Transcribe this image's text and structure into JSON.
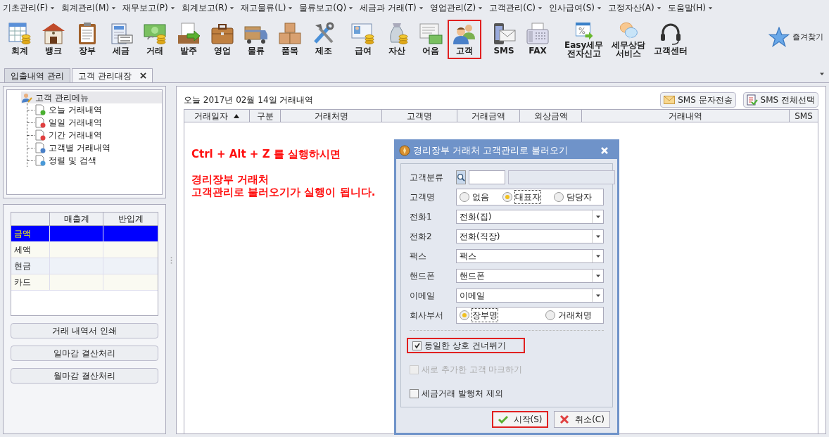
{
  "menu_bar": [
    {
      "label": "기초관리(F)"
    },
    {
      "label": "회계관리(M)"
    },
    {
      "label": "재무보고(P)"
    },
    {
      "label": "회계보고(R)"
    },
    {
      "label": "재고물류(L)"
    },
    {
      "label": "물류보고(Q)"
    },
    {
      "label": "세금과 거래(T)"
    },
    {
      "label": "영업관리(Z)"
    },
    {
      "label": "고객관리(C)"
    },
    {
      "label": "인사급여(S)"
    },
    {
      "label": "고정자산(A)"
    },
    {
      "label": "도움말(H)"
    }
  ],
  "toolbar": {
    "buttons": [
      {
        "lines": [
          "회계"
        ],
        "selected": false
      },
      {
        "lines": [
          "뱅크"
        ],
        "selected": false
      },
      {
        "lines": [
          "장부"
        ],
        "selected": false
      },
      {
        "lines": [
          "세금"
        ],
        "selected": false
      },
      {
        "lines": [
          "거래"
        ],
        "selected": false
      },
      {
        "lines": [
          "발주"
        ],
        "selected": false
      },
      {
        "lines": [
          "영업"
        ],
        "selected": false
      },
      {
        "lines": [
          "물류"
        ],
        "selected": false
      },
      {
        "lines": [
          "품목"
        ],
        "selected": false
      },
      {
        "lines": [
          "제조"
        ],
        "selected": false
      },
      {
        "lines": [
          "급여"
        ],
        "selected": false
      },
      {
        "lines": [
          "자산"
        ],
        "selected": false
      },
      {
        "lines": [
          "어음"
        ],
        "selected": false
      },
      {
        "lines": [
          "고객"
        ],
        "selected": true
      },
      {
        "lines": [
          "SMS"
        ],
        "selected": false
      },
      {
        "lines": [
          "FAX"
        ],
        "selected": false
      },
      {
        "lines": [
          "Easy세무",
          "전자신고"
        ],
        "selected": false
      },
      {
        "lines": [
          "세무상담",
          "서비스"
        ],
        "selected": false
      },
      {
        "lines": [
          "고객센터"
        ],
        "selected": false
      }
    ],
    "favorites": {
      "label": "즐겨찾기"
    }
  },
  "tabs": [
    {
      "label": "입출내역 관리",
      "selected": false
    },
    {
      "label": "고객 관리대장",
      "selected": true
    }
  ],
  "customer_menu": {
    "label": "고객 관리메뉴",
    "children": [
      {
        "label": "오늘 거래내역"
      },
      {
        "label": "일일 거래내역"
      },
      {
        "label": "기간 거래내역"
      },
      {
        "label": "고객별 거래내역"
      },
      {
        "label": "정렬 및 검색"
      }
    ]
  },
  "summary_table": {
    "columns": [
      "매출계",
      "반입계"
    ],
    "rows": [
      {
        "label": "금액",
        "selected": true
      },
      {
        "label": "세액",
        "selected": false
      },
      {
        "label": "현금",
        "selected": false
      },
      {
        "label": "카드",
        "selected": false
      }
    ]
  },
  "actions": [
    "거래 내역서 인쇄",
    "일마감 결산처리",
    "월마감 결산처리"
  ],
  "transactions": {
    "title": "오늘 2017년 02월 14일 거래내역",
    "sms_buttons": [
      {
        "label": "SMS 문자전송",
        "kind": "envelope"
      },
      {
        "label": "SMS 전체선택",
        "kind": "checklist"
      }
    ],
    "columns": [
      {
        "label": "거래일자",
        "sorted": true
      },
      {
        "label": "구분",
        "sorted": false
      },
      {
        "label": "거래처명",
        "sorted": false
      },
      {
        "label": "고객명",
        "sorted": false
      },
      {
        "label": "거래금액",
        "sorted": false
      },
      {
        "label": "외상금액",
        "sorted": false
      },
      {
        "label": "거래내역",
        "sorted": false
      },
      {
        "label": "SMS",
        "sorted": false
      }
    ],
    "notice": [
      "Ctrl + Alt + Z 를 실행하시면",
      "경리장부 거래처",
      "고객관리로 불러오기가 실행이 됩니다."
    ]
  },
  "dialog": {
    "title": "경리장부 거래처 고객관리로 불러오기",
    "fields": [
      {
        "kind": "lookup",
        "label": "고객분류"
      },
      {
        "kind": "radio",
        "label": "고객명",
        "options": [
          {
            "label": "없음",
            "selected": false
          },
          {
            "label": "대표자",
            "selected": true
          },
          {
            "label": "담당자",
            "selected": false
          }
        ]
      },
      {
        "kind": "select",
        "label": "전화1",
        "value": "전화(집)"
      },
      {
        "kind": "select",
        "label": "전화2",
        "value": "전화(직장)"
      },
      {
        "kind": "select",
        "label": "팩스",
        "value": "팩스"
      },
      {
        "kind": "select",
        "label": "핸드폰",
        "value": "핸드폰"
      },
      {
        "kind": "select",
        "label": "이메일",
        "value": "이메일"
      },
      {
        "kind": "radio",
        "label": "회사부서",
        "options": [
          {
            "label": "장부명",
            "selected": true
          },
          {
            "label": "거래처명",
            "selected": false
          }
        ]
      }
    ],
    "checkboxes": [
      {
        "label": "동일한 상호 건너뛰기",
        "checked": true,
        "disabled": false,
        "highlighted": true
      },
      {
        "label": "새로 추가한 고객 마크하기",
        "checked": false,
        "disabled": true,
        "highlighted": false
      },
      {
        "label": "세금거래 발행처 제외",
        "checked": false,
        "disabled": false,
        "highlighted": false
      }
    ],
    "buttons": [
      {
        "label": "시작(S)",
        "kind": "ok",
        "highlighted": true
      },
      {
        "label": "취소(C)",
        "kind": "cancel",
        "highlighted": false
      }
    ]
  }
}
